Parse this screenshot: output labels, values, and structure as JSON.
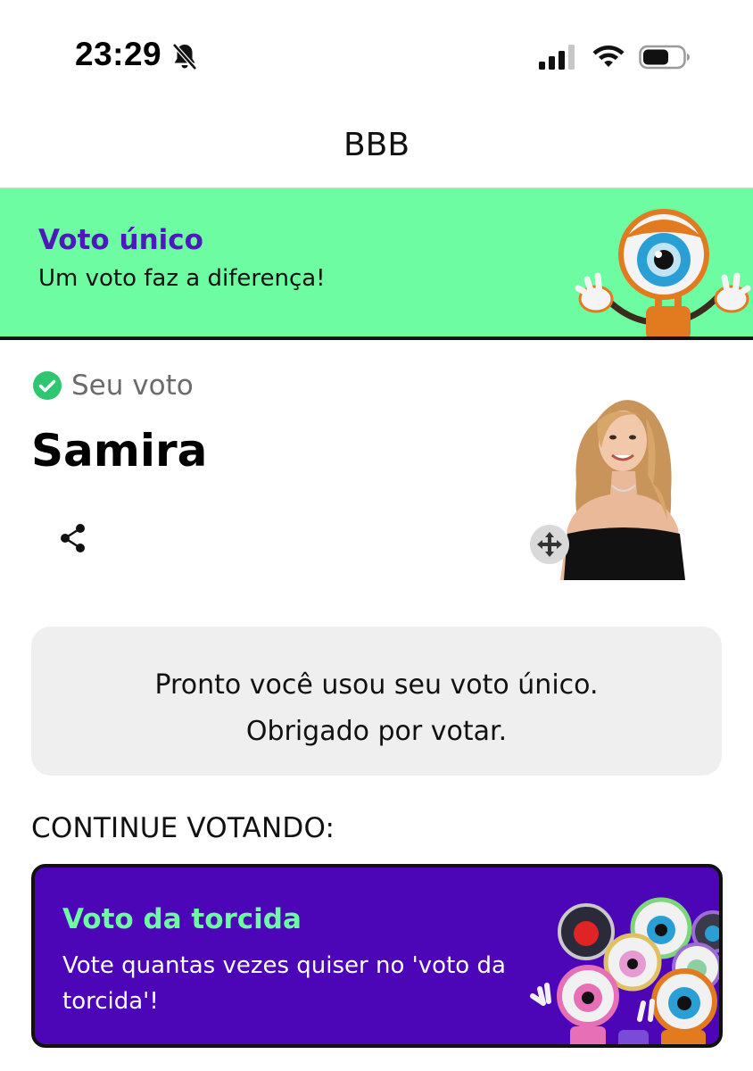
{
  "status_bar": {
    "time": "23:29",
    "icons": [
      "bell-slash-icon",
      "cellular-signal-icon",
      "wifi-icon",
      "battery-icon"
    ]
  },
  "header": {
    "title": "BBB"
  },
  "banner": {
    "title": "Voto único",
    "subtitle": "Um voto faz a diferença!",
    "bg_color": "#6efca3",
    "title_color": "#4b1bb7"
  },
  "vote": {
    "status_label": "Seu voto",
    "candidate_name": "Samira"
  },
  "info_box": {
    "line1": "Pronto você usou seu voto único.",
    "line2": "Obrigado por votar."
  },
  "continue": {
    "label": "CONTINUE VOTANDO:"
  },
  "torcida_card": {
    "title": "Voto da torcida",
    "subtitle": "Vote quantas vezes quiser no 'voto da torcida'!",
    "bg_color": "#4c06b8",
    "title_color": "#6efca3"
  }
}
